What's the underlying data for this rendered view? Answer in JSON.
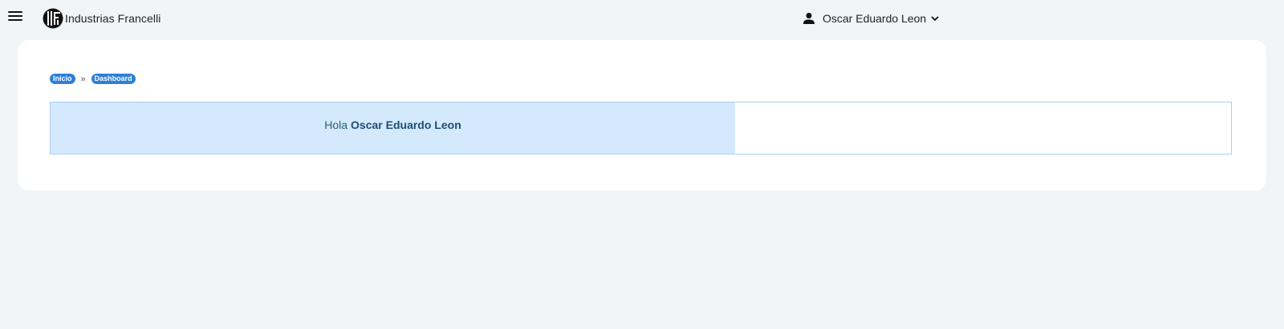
{
  "header": {
    "brand_name": "Industrias Francelli",
    "menu_icon": "hamburger-menu-icon",
    "logo_icon": "francelli-logo-icon",
    "user": {
      "name": "Oscar Eduardo Leon",
      "icon": "person-icon",
      "dropdown_icon": "chevron-down-icon"
    }
  },
  "breadcrumb": {
    "items": [
      "Inicio",
      "Dashboard"
    ],
    "separator": "»"
  },
  "welcome": {
    "greeting": "Hola",
    "name": "Oscar Eduardo Leon"
  },
  "colors": {
    "page_bg": "#f1f5f8",
    "card_bg": "#ffffff",
    "breadcrumb_badge": "#2e7fd6",
    "welcome_bg": "#d4e9fc",
    "welcome_border": "#a9d0f5",
    "welcome_text": "#2b5d80"
  }
}
